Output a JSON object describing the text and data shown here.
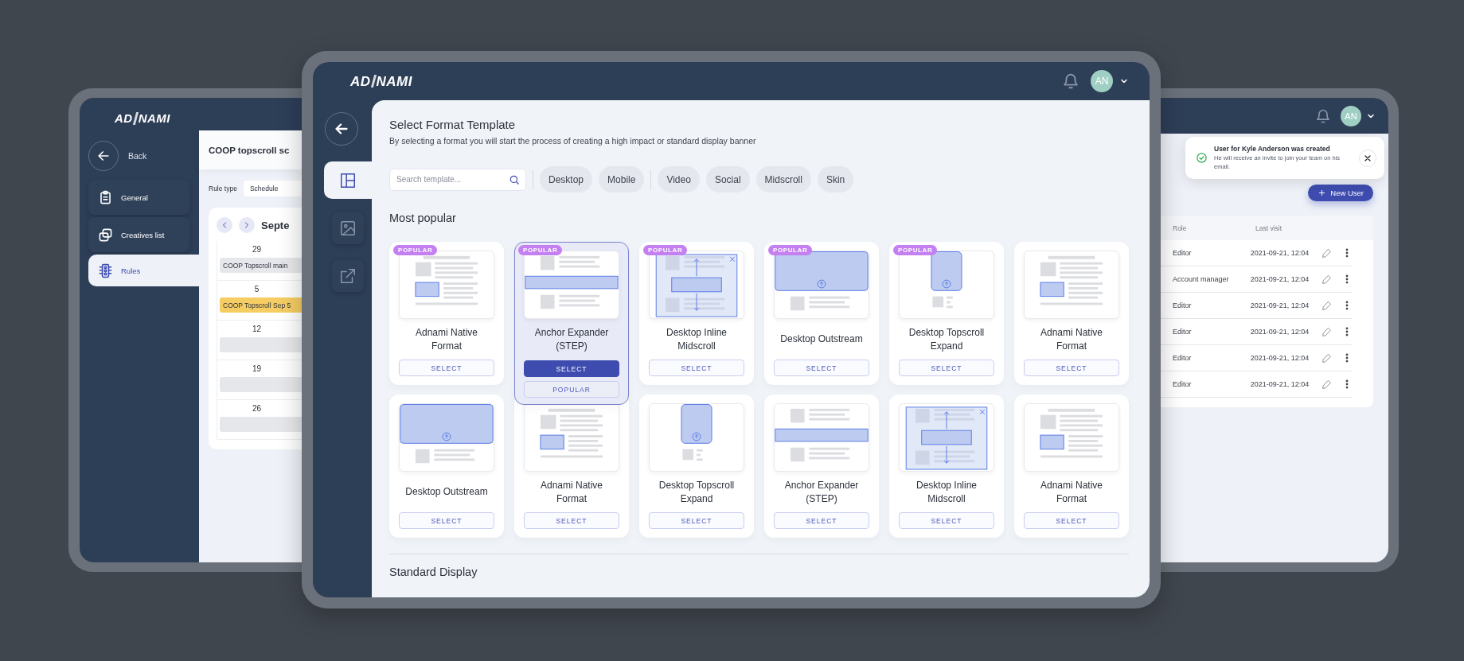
{
  "back_window": {
    "logo": {
      "left": "AD",
      "right": "NAMI"
    },
    "back_label": "Back",
    "nav": [
      {
        "label": "General",
        "selected": false
      },
      {
        "label": "Creatives list",
        "selected": false
      },
      {
        "label": "Rules",
        "selected": true
      }
    ],
    "title": "COOP topscroll sc",
    "rule_type_label": "Rule type",
    "rule_type_value": "Schedule",
    "calendar": {
      "month": "Septe",
      "weeks": [
        {
          "day": "29",
          "event": "COOP Topscroll main",
          "color": "#e6e7ea"
        },
        {
          "day": "5",
          "event": "COOP Topscroll Sep 5",
          "color": "#f5cd63"
        },
        {
          "day": "12",
          "color": "#e6e7ea"
        },
        {
          "day": "19",
          "color": "#e6e7ea"
        },
        {
          "day": "26",
          "color": "#e6e7ea"
        }
      ]
    }
  },
  "front_window": {
    "logo": {
      "left": "AD",
      "right": "NAMI"
    },
    "avatar": "AN",
    "sidebar_tabs": [
      {
        "selected": true
      },
      {
        "selected": false
      },
      {
        "selected": false
      }
    ],
    "title": "Select Format Template",
    "subtitle": "By selecting a format you will start the process of creating a high impact or standard display banner",
    "search": {
      "placeholder": "Search template..."
    },
    "filter_groups": [
      [
        {
          "label": "Desktop"
        },
        {
          "label": "Mobile"
        }
      ],
      [
        {
          "label": "Video"
        },
        {
          "label": "Social"
        },
        {
          "label": "Midscroll"
        },
        {
          "label": "Skin"
        }
      ]
    ],
    "section_title": "Most popular",
    "templates": [
      {
        "name": "Adnami Native Format",
        "kind": "native",
        "badge": "POPULAR",
        "action": "SELECT",
        "selected": false
      },
      {
        "name": "Anchor Expander (STEP)",
        "kind": "anchor",
        "badge": "POPULAR",
        "action": "SELECT",
        "secondary_action": "POPULAR",
        "selected": true
      },
      {
        "name": "Desktop Inline Midscroll",
        "kind": "midscroll",
        "badge": "POPULAR",
        "action": "SELECT",
        "selected": false
      },
      {
        "name": "Desktop Outstream",
        "kind": "outstream",
        "badge": "POPULAR",
        "action": "SELECT",
        "selected": false
      },
      {
        "name": "Desktop Topscroll Expand",
        "kind": "topscroll",
        "badge": "POPULAR",
        "action": "SELECT",
        "selected": false
      },
      {
        "name": "Adnami Native Format",
        "kind": "native",
        "action": "SELECT",
        "selected": false
      },
      {
        "name": "Desktop Outstream",
        "kind": "outstream",
        "action": "SELECT",
        "selected": false
      },
      {
        "name": "Adnami Native Format",
        "kind": "native",
        "action": "SELECT",
        "selected": false
      },
      {
        "name": "Desktop Topscroll Expand",
        "kind": "topscroll",
        "action": "SELECT",
        "selected": false
      },
      {
        "name": "Anchor Expander (STEP)",
        "kind": "anchor",
        "action": "SELECT",
        "selected": false
      },
      {
        "name": "Desktop Inline Midscroll",
        "kind": "midscroll",
        "action": "SELECT",
        "selected": false
      },
      {
        "name": "Adnami Native Format",
        "kind": "native",
        "action": "SELECT",
        "selected": false
      }
    ],
    "next_section_title": "Standard Display"
  },
  "right_window": {
    "avatar": "AN",
    "toast": {
      "title": "User for Kyle Anderson was created",
      "message": "He will receive an invite to join your team on his email."
    },
    "new_user_button": "New User",
    "table": {
      "columns": [
        "Role",
        "Last visit"
      ],
      "rows": [
        {
          "role": "Editor",
          "last_visit": "2021-09-21, 12:04"
        },
        {
          "role": "Account manager",
          "last_visit": "2021-09-21, 12:04"
        },
        {
          "role": "Editor",
          "last_visit": "2021-09-21, 12:04"
        },
        {
          "role": "Editor",
          "last_visit": "2021-09-21, 12:04"
        },
        {
          "role": "Editor",
          "last_visit": "2021-09-21, 12:04"
        },
        {
          "role": "Editor",
          "last_visit": "2021-09-21, 12:04"
        }
      ]
    }
  }
}
